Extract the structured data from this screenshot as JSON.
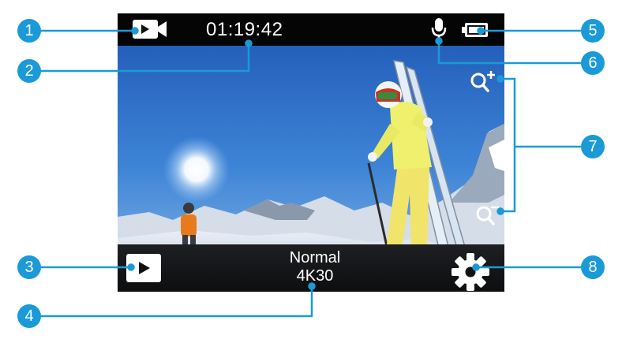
{
  "status_bar": {
    "recording_time": "01:19:42",
    "mode_icon": "video-camera-icon",
    "mic_icon": "microphone-icon",
    "battery_icon": "battery-full-icon"
  },
  "zoom": {
    "zoom_in_icon": "zoom-in-icon",
    "zoom_out_icon": "zoom-out-icon"
  },
  "bottom_bar": {
    "playback_icon": "play-icon",
    "mode_name": "Normal",
    "resolution": "4K30",
    "settings_icon": "gear-icon"
  },
  "callouts": [
    "1",
    "2",
    "3",
    "4",
    "5",
    "6",
    "7",
    "8"
  ],
  "colors": {
    "callout": "#1a9ad7",
    "bar_background": "#050505"
  }
}
